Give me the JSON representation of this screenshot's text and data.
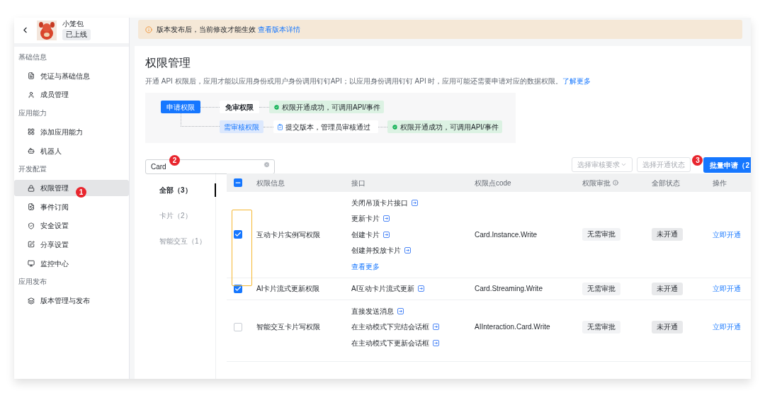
{
  "app": {
    "name": "小笼包",
    "status": "已上线"
  },
  "sidebar": {
    "groups": [
      {
        "label": "基础信息",
        "items": [
          {
            "label": "凭证与基础信息",
            "selected": false
          },
          {
            "label": "成员管理",
            "selected": false
          }
        ]
      },
      {
        "label": "应用能力",
        "items": [
          {
            "label": "添加应用能力",
            "selected": false
          },
          {
            "label": "机器人",
            "selected": false
          }
        ]
      },
      {
        "label": "开发配置",
        "items": [
          {
            "label": "权限管理",
            "selected": true,
            "annotation": "1"
          },
          {
            "label": "事件订阅",
            "selected": false
          },
          {
            "label": "安全设置",
            "selected": false
          },
          {
            "label": "分享设置",
            "selected": false
          },
          {
            "label": "监控中心",
            "selected": false
          }
        ]
      },
      {
        "label": "应用发布",
        "items": [
          {
            "label": "版本管理与发布",
            "selected": false
          }
        ]
      }
    ]
  },
  "notice": {
    "text": "版本发布后，当前修改才能生效",
    "link": "查看版本详情"
  },
  "page": {
    "title": "权限管理",
    "description": "开通 API 权限后，应用才能以应用身份或用户身份调用钉钉API；以应用身份调用钉钉 API 时，应用可能还需要申请对应的数据权限。",
    "link": "了解更多"
  },
  "flow": {
    "start": "申请权限",
    "free": "免审权限",
    "review": "需审核权限",
    "submit": "提交版本，管理员审核通过",
    "success": [
      "权限开通成功，可调用API/事件",
      "权限开通成功，可调用API/事件"
    ]
  },
  "search": {
    "value": "Card",
    "annotation": "2"
  },
  "filters": [
    {
      "placeholder": "选择审核要求"
    },
    {
      "placeholder": "选择开通状态"
    }
  ],
  "batch_button": {
    "label": "批量申请（2",
    "annotation": "3"
  },
  "categories": [
    {
      "label": "全部（3）",
      "selected": true
    },
    {
      "label": "卡片（2）",
      "selected": false
    },
    {
      "label": "智能交互（1）",
      "selected": false
    }
  ],
  "table": {
    "header_partial": true,
    "checkbox_highlight": true,
    "columns": [
      "权限信息",
      "接口",
      "权限点code",
      "权限审批",
      "全部状态",
      "操作"
    ],
    "rows": [
      {
        "checked": true,
        "name": "互动卡片实例写权限",
        "apis": [
          "关闭吊顶卡片接口",
          "更新卡片",
          "创建卡片",
          "创建并投放卡片"
        ],
        "more": "查看更多",
        "code": "Card.Instance.Write",
        "approval": "无需审批",
        "status": "未开通",
        "action": "立即开通"
      },
      {
        "checked": true,
        "name": "AI卡片流式更新权限",
        "apis": [
          "AI互动卡片流式更新"
        ],
        "code": "Card.Streaming.Write",
        "approval": "无需审批",
        "status": "未开通",
        "action": "立即开通"
      },
      {
        "checked": false,
        "name": "智能交互卡片写权限",
        "apis": [
          "直接发送消息",
          "在主动模式下完结会话框",
          "在主动模式下更新会话框"
        ],
        "code": "AIInteraction.Card.Write",
        "approval": "无需审批",
        "status": "未开通",
        "action": "立即开通"
      }
    ]
  }
}
